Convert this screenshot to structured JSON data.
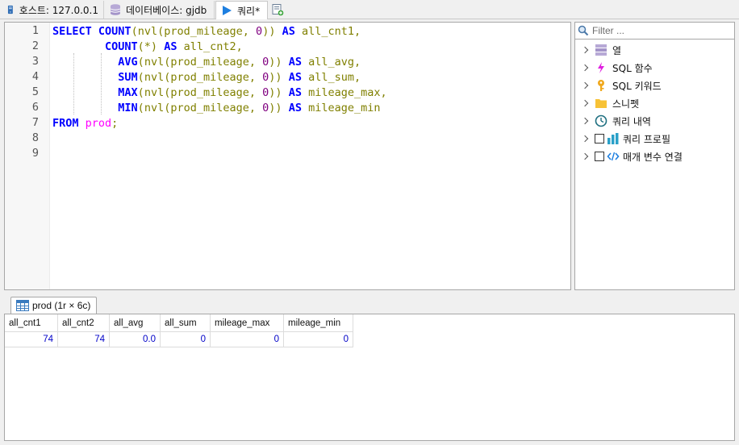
{
  "tabs": {
    "host": "호스트: 127.0.0.1",
    "database": "데이터베이스: gjdb",
    "query": "쿼리*"
  },
  "editor": {
    "line_numbers": [
      "1",
      "2",
      "3",
      "4",
      "5",
      "6",
      "7",
      "8",
      "9"
    ]
  },
  "side_panel": {
    "filter_placeholder": "Filter ...",
    "items": [
      {
        "label": "열",
        "icon": "columns-icon"
      },
      {
        "label": "SQL 함수",
        "icon": "lightning-icon"
      },
      {
        "label": "SQL 키워드",
        "icon": "key-icon"
      },
      {
        "label": "스니펫",
        "icon": "folder-icon"
      },
      {
        "label": "쿼리 내역",
        "icon": "clock-icon"
      },
      {
        "label": "쿼리 프로필",
        "icon": "bar-chart-icon"
      },
      {
        "label": "매개 변수 연결",
        "icon": "code-icon"
      }
    ]
  },
  "results": {
    "tab_label": "prod (1r × 6c)",
    "columns": [
      "all_cnt1",
      "all_cnt2",
      "all_avg",
      "all_sum",
      "mileage_max",
      "mileage_min"
    ],
    "rows": [
      [
        "74",
        "74",
        "0.0",
        "0",
        "0",
        "0"
      ]
    ]
  },
  "colors": {
    "keyword": "#0000ff",
    "identifier": "#808000",
    "number": "#800080",
    "table": "#ff00ff",
    "cell_value": "#0000c8"
  }
}
